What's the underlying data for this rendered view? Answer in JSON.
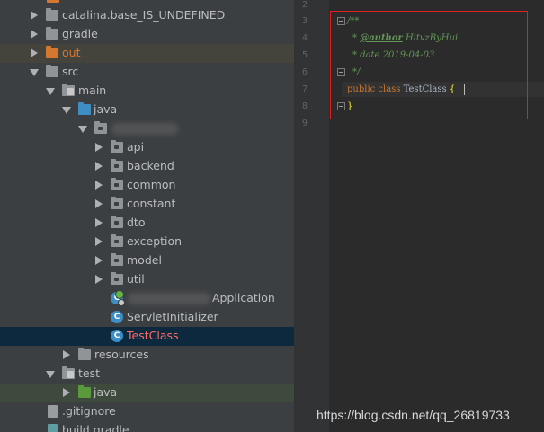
{
  "colors": {
    "tree_bg": "#3c3f41",
    "editor_bg": "#2b2b2b",
    "selected_row": "#0d293e",
    "excluded_folder": "#d5782f",
    "source_folder": "#3d8ec3",
    "test_folder": "#5b9a3c",
    "highlight_box": "#e02020"
  },
  "project_tree": {
    "items": [
      {
        "label": "catalina.base_IS_UNDEFINED",
        "icon": "folder-icon"
      },
      {
        "label": "gradle",
        "icon": "folder-icon"
      },
      {
        "label": "out",
        "icon": "excluded-folder-icon"
      },
      {
        "label": "src",
        "icon": "folder-icon"
      },
      {
        "label": "main",
        "icon": "module-folder-icon"
      },
      {
        "label": "java",
        "icon": "source-folder-icon"
      },
      {
        "label": "",
        "icon": "package-icon",
        "note": "blurred"
      },
      {
        "label": "api",
        "icon": "package-icon"
      },
      {
        "label": "backend",
        "icon": "package-icon"
      },
      {
        "label": "common",
        "icon": "package-icon"
      },
      {
        "label": "constant",
        "icon": "package-icon"
      },
      {
        "label": "dto",
        "icon": "package-icon"
      },
      {
        "label": "exception",
        "icon": "package-icon"
      },
      {
        "label": "model",
        "icon": "package-icon"
      },
      {
        "label": "util",
        "icon": "package-icon"
      },
      {
        "label": "Application",
        "icon": "spring-boot-class-icon"
      },
      {
        "label": "ServletInitializer",
        "icon": "class-icon"
      },
      {
        "label": "TestClass",
        "icon": "class-icon"
      },
      {
        "label": "resources",
        "icon": "folder-icon"
      },
      {
        "label": "test",
        "icon": "module-folder-icon"
      },
      {
        "label": "java",
        "icon": "test-source-folder-icon"
      },
      {
        "label": ".gitignore",
        "icon": "file-icon"
      },
      {
        "label": "build.gradle",
        "icon": "gradle-file-icon"
      }
    ]
  },
  "editor": {
    "line_numbers": [
      "2",
      "3",
      "4",
      "5",
      "6",
      "7",
      "8",
      "9"
    ],
    "lines": {
      "l3_open": "/**",
      "l4_star": "* ",
      "l4_tag": "@author",
      "l4_value": " HitvzByHui",
      "l5": "* date 2019-04-03",
      "l6": "*/",
      "l7_kw": "public class ",
      "l7_name": "TestClass",
      "l7_brace": " {",
      "l8_brace": "}"
    }
  },
  "watermark": "https://blog.csdn.net/qq_26819733"
}
